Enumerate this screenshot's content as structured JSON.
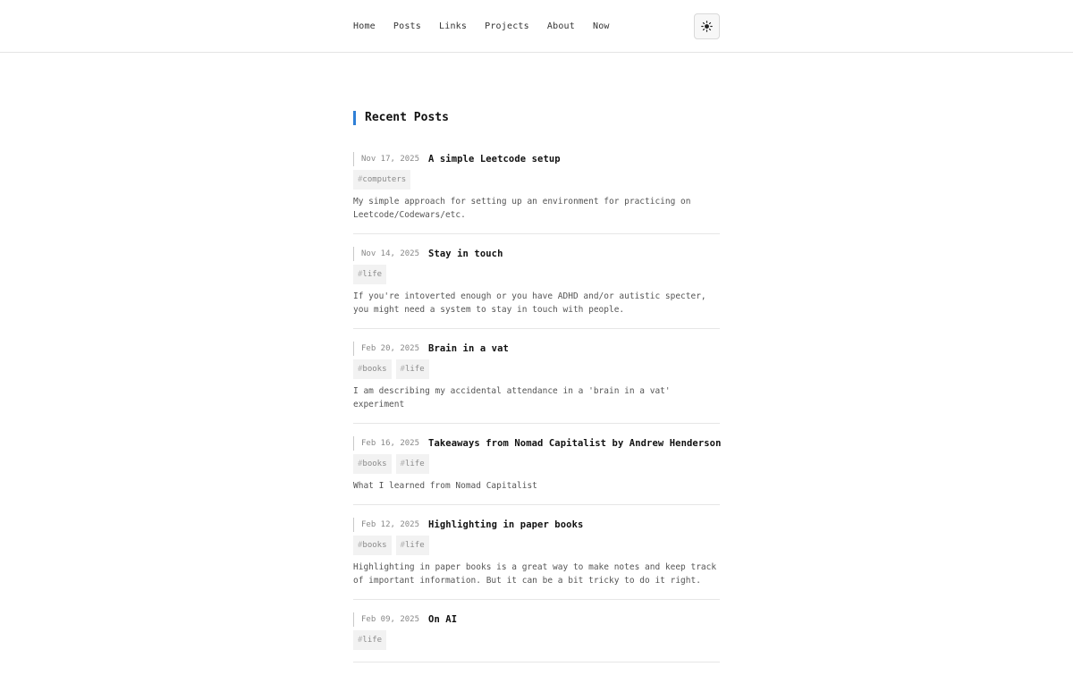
{
  "nav": {
    "items": [
      "Home",
      "Posts",
      "Links",
      "Projects",
      "About",
      "Now"
    ]
  },
  "theme_toggle": {
    "icon": "sun-icon"
  },
  "section": {
    "title": "Recent Posts",
    "accent_color": "#2f7fd6"
  },
  "posts": [
    {
      "date": "Nov 17, 2025",
      "title": "A simple Leetcode setup",
      "tags": [
        "computers"
      ],
      "description": "My simple approach for setting up an environment for practicing on Leetcode/Codewars/etc."
    },
    {
      "date": "Nov 14, 2025",
      "title": "Stay in touch",
      "tags": [
        "life"
      ],
      "description": "If you're intoverted enough or you have ADHD and/or autistic specter, you might need a system to stay in touch with people."
    },
    {
      "date": "Feb 20, 2025",
      "title": "Brain in a vat",
      "tags": [
        "books",
        "life"
      ],
      "description": "I am describing my accidental attendance in a 'brain in a vat' experiment"
    },
    {
      "date": "Feb 16, 2025",
      "title": "Takeaways from Nomad Capitalist by Andrew Henderson",
      "tags": [
        "books",
        "life"
      ],
      "description": "What I learned from Nomad Capitalist"
    },
    {
      "date": "Feb 12, 2025",
      "title": "Highlighting in paper books",
      "tags": [
        "books",
        "life"
      ],
      "description": "Highlighting in paper books is a great way to make notes and keep track of important information. But it can be a bit tricky to do it right."
    },
    {
      "date": "Feb 09, 2025",
      "title": "On AI",
      "tags": [
        "life"
      ],
      "description": ""
    }
  ]
}
